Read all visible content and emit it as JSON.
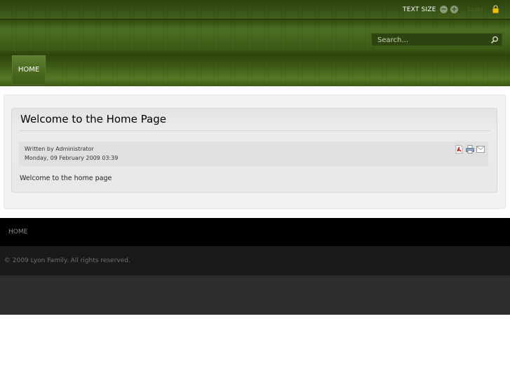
{
  "header": {
    "text_size_label": "TEXT SIZE",
    "decrease_symbol": "−",
    "increase_symbol": "+",
    "login_label": "Login",
    "search_placeholder": "Search..."
  },
  "nav": {
    "items": [
      {
        "label": "HOME"
      }
    ]
  },
  "article": {
    "title": "Welcome to the Home Page",
    "written_by": "Written by Administrator",
    "date": "Monday, 09 February 2009 03:39",
    "body": "Welcome to the home page"
  },
  "footer": {
    "nav_items": [
      {
        "label": "HOME"
      }
    ],
    "copyright": "© 2009 Lyon Family.  All rights reserved."
  },
  "icons": {
    "lock": "lock-icon",
    "search": "magnifier-icon",
    "pdf": "pdf-icon",
    "print": "printer-icon",
    "email": "envelope-icon"
  },
  "colors": {
    "header_green": "#40601a",
    "footer_black": "#000000",
    "footer_dark": "#1a1a1a",
    "footer_bottom": "#2d2d2d"
  }
}
